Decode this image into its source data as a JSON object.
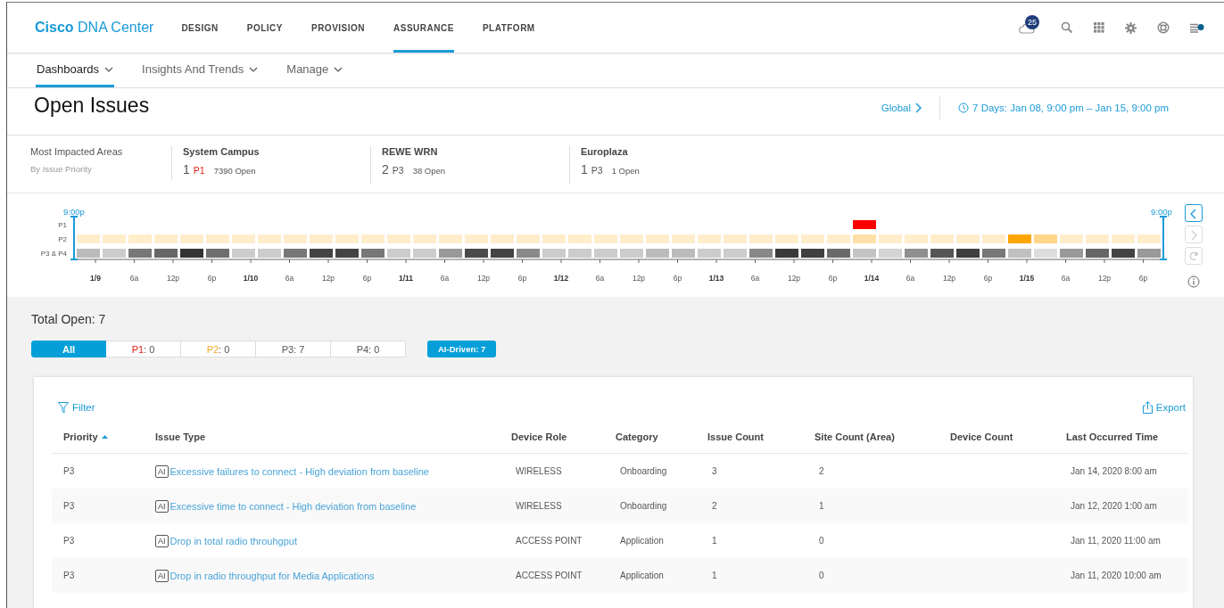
{
  "header": {
    "brand_bold": "Cisco",
    "brand_rest": "DNA Center",
    "nav": [
      {
        "label": "DESIGN",
        "selected": false
      },
      {
        "label": "POLICY",
        "selected": false
      },
      {
        "label": "PROVISION",
        "selected": false
      },
      {
        "label": "ASSURANCE",
        "selected": true
      },
      {
        "label": "PLATFORM",
        "selected": false
      }
    ],
    "notification_badge": "25"
  },
  "subnav": [
    {
      "label": "Dashboards",
      "selected": true
    },
    {
      "label": "Insights And Trends",
      "selected": false
    },
    {
      "label": "Manage",
      "selected": false
    }
  ],
  "page_title": "Open Issues",
  "scope_link": "Global",
  "time_range": "7 Days: Jan 08, 9:00 pm – Jan 15, 9:00 pm",
  "impacted": {
    "title": "Most Impacted Areas",
    "subtitle": "By Issue Priority",
    "areas": [
      {
        "name": "System Campus",
        "count": "1",
        "priority": "P1",
        "color": "#e2231a",
        "open": "7390 Open"
      },
      {
        "name": "REWE WRN",
        "count": "2",
        "priority": "P3",
        "color": "#555555",
        "open": "38 Open"
      },
      {
        "name": "Europlaza",
        "count": "1",
        "priority": "P3",
        "color": "#555555",
        "open": "1 Open"
      }
    ]
  },
  "timeline": {
    "start_label": "9:00p",
    "end_label": "9:00p",
    "rows": [
      {
        "label": "P1",
        "cells": [
          {},
          {},
          {},
          {},
          {},
          {},
          {},
          {},
          {},
          {},
          {},
          {},
          {},
          {},
          {},
          {},
          {},
          {},
          {},
          {},
          {},
          {},
          {},
          {},
          {},
          {},
          {},
          {},
          {},
          {},
          {
            "color": "#ff0000"
          },
          {},
          {},
          {},
          {},
          {},
          {},
          {},
          {},
          {},
          {},
          {}
        ]
      },
      {
        "label": "P2",
        "cells": [
          {
            "color": "#ffedcc"
          },
          {
            "color": "#ffedcc"
          },
          {
            "color": "#ffedcc"
          },
          {
            "color": "#ffedcc"
          },
          {
            "color": "#ffedcc"
          },
          {
            "color": "#ffedcc"
          },
          {
            "color": "#ffedcc"
          },
          {
            "color": "#ffedcc"
          },
          {
            "color": "#ffedcc"
          },
          {
            "color": "#ffedcc"
          },
          {
            "color": "#ffedcc"
          },
          {
            "color": "#ffedcc"
          },
          {
            "color": "#ffedcc"
          },
          {
            "color": "#ffedcc"
          },
          {
            "color": "#ffedcc"
          },
          {
            "color": "#ffedcc"
          },
          {
            "color": "#ffedcc"
          },
          {
            "color": "#ffedcc"
          },
          {
            "color": "#ffedcc"
          },
          {
            "color": "#ffedcc"
          },
          {
            "color": "#ffedcc"
          },
          {
            "color": "#ffedcc"
          },
          {
            "color": "#ffedcc"
          },
          {
            "color": "#ffedcc"
          },
          {
            "color": "#ffedcc"
          },
          {
            "color": "#ffedcc"
          },
          {
            "color": "#ffedcc"
          },
          {
            "color": "#ffedcc"
          },
          {
            "color": "#ffedcc"
          },
          {
            "color": "#ffedcc"
          },
          {
            "color": "#ffe0a8"
          },
          {
            "color": "#ffedcc"
          },
          {
            "color": "#ffedcc"
          },
          {
            "color": "#ffedcc"
          },
          {
            "color": "#ffedcc"
          },
          {
            "color": "#ffedcc"
          },
          {
            "color": "#ffa500"
          },
          {
            "color": "#ffd68a"
          },
          {
            "color": "#ffedcc"
          },
          {
            "color": "#ffedcc"
          },
          {
            "color": "#ffedcc"
          },
          {
            "color": "#ffedcc"
          }
        ]
      },
      {
        "label": "P3 & P4",
        "cells": [
          {
            "color": "#bbbbbb"
          },
          {
            "color": "#cccccc"
          },
          {
            "color": "#777777"
          },
          {
            "color": "#666666"
          },
          {
            "color": "#333333"
          },
          {
            "color": "#6f6f6f"
          },
          {
            "color": "#cccccc"
          },
          {
            "color": "#cccccc"
          },
          {
            "color": "#777777"
          },
          {
            "color": "#444444"
          },
          {
            "color": "#444444"
          },
          {
            "color": "#777777"
          },
          {
            "color": "#cccccc"
          },
          {
            "color": "#cccccc"
          },
          {
            "color": "#999999"
          },
          {
            "color": "#4a4a4a"
          },
          {
            "color": "#444444"
          },
          {
            "color": "#8a8a8a"
          },
          {
            "color": "#cccccc"
          },
          {
            "color": "#cccccc"
          },
          {
            "color": "#cccccc"
          },
          {
            "color": "#cccccc"
          },
          {
            "color": "#bbbbbb"
          },
          {
            "color": "#bbbbbb"
          },
          {
            "color": "#cccccc"
          },
          {
            "color": "#cccccc"
          },
          {
            "color": "#888888"
          },
          {
            "color": "#3a3a3a"
          },
          {
            "color": "#3f3f3f"
          },
          {
            "color": "#6a6a6a"
          },
          {
            "color": "#c4c4c4"
          },
          {
            "color": "#d4d4d4"
          },
          {
            "color": "#8f8f8f"
          },
          {
            "color": "#555555"
          },
          {
            "color": "#3f3f3f"
          },
          {
            "color": "#777777"
          },
          {
            "color": "#c0c0c0"
          },
          {
            "color": "#dddddd"
          },
          {
            "color": "#999999"
          },
          {
            "color": "#666666"
          },
          {
            "color": "#444444"
          },
          {
            "color": "#999999"
          }
        ]
      }
    ],
    "ticks": [
      {
        "label": "1/9",
        "day": true
      },
      {
        "label": "6a",
        "day": false
      },
      {
        "label": "12p",
        "day": false
      },
      {
        "label": "6p",
        "day": false
      },
      {
        "label": "1/10",
        "day": true
      },
      {
        "label": "6a",
        "day": false
      },
      {
        "label": "12p",
        "day": false
      },
      {
        "label": "6p",
        "day": false
      },
      {
        "label": "1/11",
        "day": true
      },
      {
        "label": "6a",
        "day": false
      },
      {
        "label": "12p",
        "day": false
      },
      {
        "label": "6p",
        "day": false
      },
      {
        "label": "1/12",
        "day": true
      },
      {
        "label": "6a",
        "day": false
      },
      {
        "label": "12p",
        "day": false
      },
      {
        "label": "6p",
        "day": false
      },
      {
        "label": "1/13",
        "day": true
      },
      {
        "label": "6a",
        "day": false
      },
      {
        "label": "12p",
        "day": false
      },
      {
        "label": "6p",
        "day": false
      },
      {
        "label": "1/14",
        "day": true
      },
      {
        "label": "6a",
        "day": false
      },
      {
        "label": "12p",
        "day": false
      },
      {
        "label": "6p",
        "day": false
      },
      {
        "label": "1/15",
        "day": true
      },
      {
        "label": "6a",
        "day": false
      },
      {
        "label": "12p",
        "day": false
      },
      {
        "label": "6p",
        "day": false
      }
    ],
    "controls": [
      {
        "kind": "prev",
        "disabled": false
      },
      {
        "kind": "next",
        "disabled": true
      },
      {
        "kind": "reset",
        "disabled": true
      }
    ]
  },
  "total_open": "Total Open: 7",
  "priority_tabs": [
    {
      "label": "All",
      "selected": true
    },
    {
      "label": "P1",
      "count": ": 0",
      "color": "#e2231a",
      "selected": false
    },
    {
      "label": "P2",
      "count": ": 0",
      "color": "#f5a623",
      "selected": false
    },
    {
      "label": "P3",
      "count": ": 7",
      "color": "#555555",
      "selected": false
    },
    {
      "label": "P4",
      "count": ": 0",
      "color": "#555555",
      "selected": false
    }
  ],
  "ai_driven": "AI-Driven: 7",
  "filter": "Filter",
  "export": "Export",
  "table": {
    "columns": [
      {
        "label": "Priority",
        "sorted": true
      },
      {
        "label": "Issue Type",
        "sorted": false
      },
      {
        "label": "Device Role",
        "sorted": false
      },
      {
        "label": "Category",
        "sorted": false
      },
      {
        "label": "Issue Count",
        "sorted": false
      },
      {
        "label": "Site Count (Area)",
        "sorted": false
      },
      {
        "label": "Device Count",
        "sorted": false
      },
      {
        "label": "Last Occurred Time",
        "sorted": false
      }
    ],
    "rows": [
      {
        "priority": "P3",
        "ai_badge": "AI",
        "issue": "Excessive failures to connect - High deviation from baseline",
        "role": "WIRELESS",
        "category": "Onboarding",
        "issue_count": "3",
        "site_count": "2",
        "last": "Jan 14, 2020 8:00 am"
      },
      {
        "priority": "P3",
        "ai_badge": "AI",
        "issue": "Excessive time to connect - High deviation from baseline",
        "role": "WIRELESS",
        "category": "Onboarding",
        "issue_count": "2",
        "site_count": "1",
        "last": "Jan 12, 2020 1:00 am"
      },
      {
        "priority": "P3",
        "ai_badge": "AI",
        "issue": "Drop in total radio throuhgput",
        "role": "ACCESS POINT",
        "category": "Application",
        "issue_count": "1",
        "site_count": "0",
        "last": "Jan 11, 2020 11:00 am"
      },
      {
        "priority": "P3",
        "ai_badge": "AI",
        "issue": "Drop in radio throughput for Media Applications",
        "role": "ACCESS POINT",
        "category": "Application",
        "issue_count": "1",
        "site_count": "0",
        "last": "Jan 11, 2020 10:00 am"
      }
    ]
  }
}
